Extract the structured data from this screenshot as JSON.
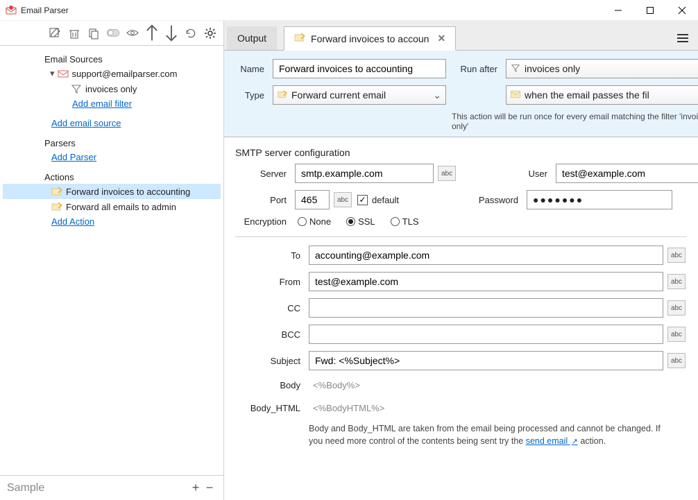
{
  "app_title": "Email Parser",
  "sidebar": {
    "sections": {
      "email_sources": "Email Sources",
      "parsers": "Parsers",
      "actions": "Actions"
    },
    "source_account": "support@emailparser.com",
    "filter_name": "invoices only",
    "add_email_filter": "Add email filter",
    "add_email_source": "Add email source",
    "add_parser": "Add Parser",
    "action1": "Forward invoices to accounting",
    "action2": "Forward all emails to admin",
    "add_action": "Add Action",
    "sample": "Sample"
  },
  "tabs": {
    "output": "Output",
    "active_tab": "Forward invoices to accoun"
  },
  "header": {
    "name_label": "Name",
    "name_value": "Forward invoices to accounting",
    "type_label": "Type",
    "type_value": "Forward current email",
    "runafter_label": "Run after",
    "runafter_value": "invoices only",
    "when_value": "when the email passes the fil",
    "note": "This action will be run once for every email matching the filter 'invoices only'"
  },
  "smtp": {
    "title": "SMTP server configuration",
    "server_label": "Server",
    "server_value": "smtp.example.com",
    "user_label": "User",
    "user_value": "test@example.com",
    "port_label": "Port",
    "port_value": "465",
    "default_label": "default",
    "password_label": "Password",
    "password_value": "●●●●●●●",
    "encryption_label": "Encryption",
    "enc_none": "None",
    "enc_ssl": "SSL",
    "enc_tls": "TLS"
  },
  "email": {
    "to_label": "To",
    "to_value": "accounting@example.com",
    "from_label": "From",
    "from_value": "test@example.com",
    "cc_label": "CC",
    "cc_value": "",
    "bcc_label": "BCC",
    "bcc_value": "",
    "subject_label": "Subject",
    "subject_value": "Fwd: <%Subject%>",
    "body_label": "Body",
    "body_value": "<%Body%>",
    "body_html_label": "Body_HTML",
    "body_html_value": "<%BodyHTML%>",
    "note_pre": "Body and Body_HTML are taken from the email being processed and cannot be changed. If you need more control of the contents being sent try the ",
    "note_link": "send email",
    "note_post": " action."
  },
  "misc": {
    "abc": "abc"
  }
}
